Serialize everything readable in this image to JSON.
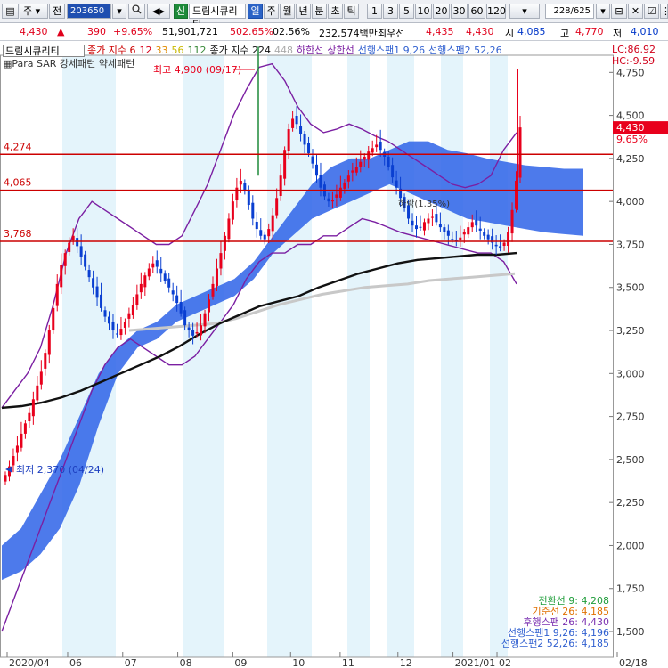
{
  "toolbar": {
    "type_selector": "주",
    "prev_label": "전",
    "stock_code": "203650",
    "sin_badge": "신",
    "stock_name": "드림시큐리티",
    "period_tabs": [
      "일",
      "주",
      "월",
      "년",
      "분",
      "초",
      "틱"
    ],
    "active_period": "일",
    "interval_buttons": [
      "1",
      "3",
      "5",
      "10",
      "20",
      "30",
      "60",
      "120"
    ],
    "pager": "228/625"
  },
  "info": {
    "price": "4,430",
    "change": "390",
    "change_pct": "+9.65%",
    "volume": "51,901,721",
    "vol_ratio": "502.65%",
    "turnover": "02.56%",
    "amount": "232,574백만",
    "best_label": "최우선",
    "ask": "4,435",
    "bid": "4,430",
    "open_label": "시",
    "open": "4,085",
    "high_label": "고",
    "high": "4,770",
    "low_label": "저",
    "low": "4,010"
  },
  "legend": {
    "indicator_box": "드림시큐리티",
    "ma_label": "종가 지수 6",
    "ma_periods": [
      "12",
      "33",
      "56",
      "112"
    ],
    "ma2_label": "종가 지수 224",
    "ma2_extra": "448",
    "lower_band": "하한선",
    "upper_band": "상한선",
    "span1": "선행스팬1 9,26",
    "span2": "선행스팬2 52,26",
    "sar": "Para SAR 강세패턴 약세패턴",
    "lc": "LC:86.92",
    "hc": "HC:-9.59"
  },
  "chart_data": {
    "type": "candlestick",
    "period": "daily",
    "ylim": [
      1350,
      4850
    ],
    "y_ticks": [
      1500,
      1750,
      2000,
      2250,
      2500,
      2750,
      3000,
      3250,
      3500,
      3750,
      4000,
      4250,
      4500,
      4750
    ],
    "x_ticks": [
      {
        "label": "2020/04",
        "month": 0.0
      },
      {
        "label": "06",
        "month": 1.1
      },
      {
        "label": "07",
        "month": 2.1
      },
      {
        "label": "08",
        "month": 3.1
      },
      {
        "label": "09",
        "month": 4.1
      },
      {
        "label": "10",
        "month": 5.15
      },
      {
        "label": "11",
        "month": 6.05
      },
      {
        "label": "12",
        "month": 7.1
      },
      {
        "label": "2021/01",
        "month": 8.1
      },
      {
        "label": "02",
        "month": 8.9
      },
      {
        "label": "02/18",
        "month": 11.5
      }
    ],
    "price_lines": [
      {
        "label": "4,274",
        "value": 4274
      },
      {
        "label": "4,065",
        "value": 4065
      },
      {
        "label": "3,768",
        "value": 3768
      }
    ],
    "current_price": {
      "label": "4,430",
      "value": 4430,
      "pct": "9.65%"
    },
    "annotations": {
      "high": "최고 4,900 (09/17)",
      "low": "최저 2,370 (04/24)",
      "mid": "하락(1.35%)"
    },
    "ichimoku_values": [
      {
        "label": "전환선 9: 4,208",
        "color": "#1f9d3a"
      },
      {
        "label": "기준선 26: 4,185",
        "color": "#e07000"
      },
      {
        "label": "후행스팬 26: 4,430",
        "color": "#7a2fb0"
      },
      {
        "label": "선행스팬1 9,26: 4,196",
        "color": "#2f5fd0"
      },
      {
        "label": "선행스팬2 52,26: 4,185",
        "color": "#2f5fd0"
      }
    ],
    "closes": [
      2410,
      2460,
      2520,
      2580,
      2650,
      2710,
      2770,
      2850,
      2930,
      3010,
      3120,
      3250,
      3380,
      3520,
      3630,
      3700,
      3760,
      3800,
      3740,
      3680,
      3620,
      3560,
      3500,
      3440,
      3380,
      3330,
      3290,
      3250,
      3230,
      3260,
      3300,
      3350,
      3400,
      3460,
      3520,
      3570,
      3610,
      3640,
      3620,
      3580,
      3540,
      3500,
      3460,
      3410,
      3350,
      3280,
      3250,
      3220,
      3240,
      3280,
      3350,
      3430,
      3520,
      3610,
      3700,
      3800,
      3900,
      4000,
      4080,
      4120,
      4060,
      3980,
      3900,
      3840,
      3800,
      3780,
      3840,
      3920,
      4020,
      4150,
      4300,
      4420,
      4480,
      4450,
      4390,
      4330,
      4280,
      4220,
      4150,
      4080,
      4030,
      4000,
      4010,
      4040,
      4080,
      4110,
      4150,
      4180,
      4200,
      4230,
      4260,
      4290,
      4310,
      4330,
      4300,
      4260,
      4200,
      4140,
      4080,
      4020,
      3960,
      3900,
      3860,
      3840,
      3850,
      3880,
      3900,
      3910,
      3880,
      3850,
      3820,
      3800,
      3780,
      3770,
      3790,
      3820,
      3850,
      3880,
      3860,
      3830,
      3800,
      3780,
      3760,
      3740,
      3730,
      3760,
      3820,
      3950,
      4120,
      4430
    ],
    "bands": {
      "upper": [
        2800,
        2900,
        3000,
        3150,
        3400,
        3700,
        3900,
        4000,
        3950,
        3900,
        3850,
        3800,
        3750,
        3750,
        3800,
        3950,
        4100,
        4300,
        4500,
        4650,
        4780,
        4800,
        4700,
        4550,
        4450,
        4400,
        4420,
        4450,
        4420,
        4380,
        4350,
        4300,
        4250,
        4200,
        4150,
        4100,
        4080,
        4100,
        4150,
        4300,
        4400
      ],
      "lower": [
        1500,
        1700,
        1900,
        2100,
        2300,
        2500,
        2700,
        2900,
        3050,
        3150,
        3200,
        3150,
        3100,
        3050,
        3050,
        3100,
        3200,
        3300,
        3400,
        3550,
        3650,
        3700,
        3700,
        3750,
        3750,
        3800,
        3800,
        3850,
        3900,
        3880,
        3850,
        3820,
        3800,
        3780,
        3760,
        3740,
        3720,
        3700,
        3700,
        3650,
        3520
      ]
    },
    "ma_long": [
      2800,
      2810,
      2830,
      2860,
      2900,
      2950,
      3000,
      3050,
      3100,
      3160,
      3230,
      3290,
      3340,
      3390,
      3420,
      3450,
      3500,
      3540,
      3580,
      3610,
      3640,
      3660,
      3670,
      3680,
      3690,
      3690,
      3700
    ],
    "ma_grey": [
      3250,
      3260,
      3270,
      3280,
      3290,
      3320,
      3360,
      3400,
      3430,
      3460,
      3480,
      3500,
      3510,
      3520,
      3540,
      3550,
      3560,
      3570,
      3580
    ],
    "cloud_top": [
      2000,
      2100,
      2300,
      2500,
      2750,
      3000,
      3150,
      3250,
      3300,
      3400,
      3450,
      3500,
      3550,
      3650,
      3800,
      3950,
      4100,
      4200,
      4250,
      4250,
      4300,
      4350,
      4350,
      4300,
      4280,
      4250,
      4230,
      4210,
      4200,
      4190,
      4190
    ],
    "cloud_bottom": [
      1800,
      1850,
      1950,
      2100,
      2350,
      2700,
      3000,
      3150,
      3200,
      3300,
      3350,
      3400,
      3450,
      3550,
      3700,
      3800,
      3900,
      3950,
      4000,
      4050,
      4100,
      4050,
      4000,
      3950,
      3900,
      3880,
      3860,
      3840,
      3820,
      3810,
      3800
    ]
  },
  "colors": {
    "up": "#e8001c",
    "down": "#0a3fd1",
    "cloud": "#2e63e8",
    "band": "#7b1fa2",
    "hline": "#cc0000",
    "shade": "#e4f4fb"
  }
}
